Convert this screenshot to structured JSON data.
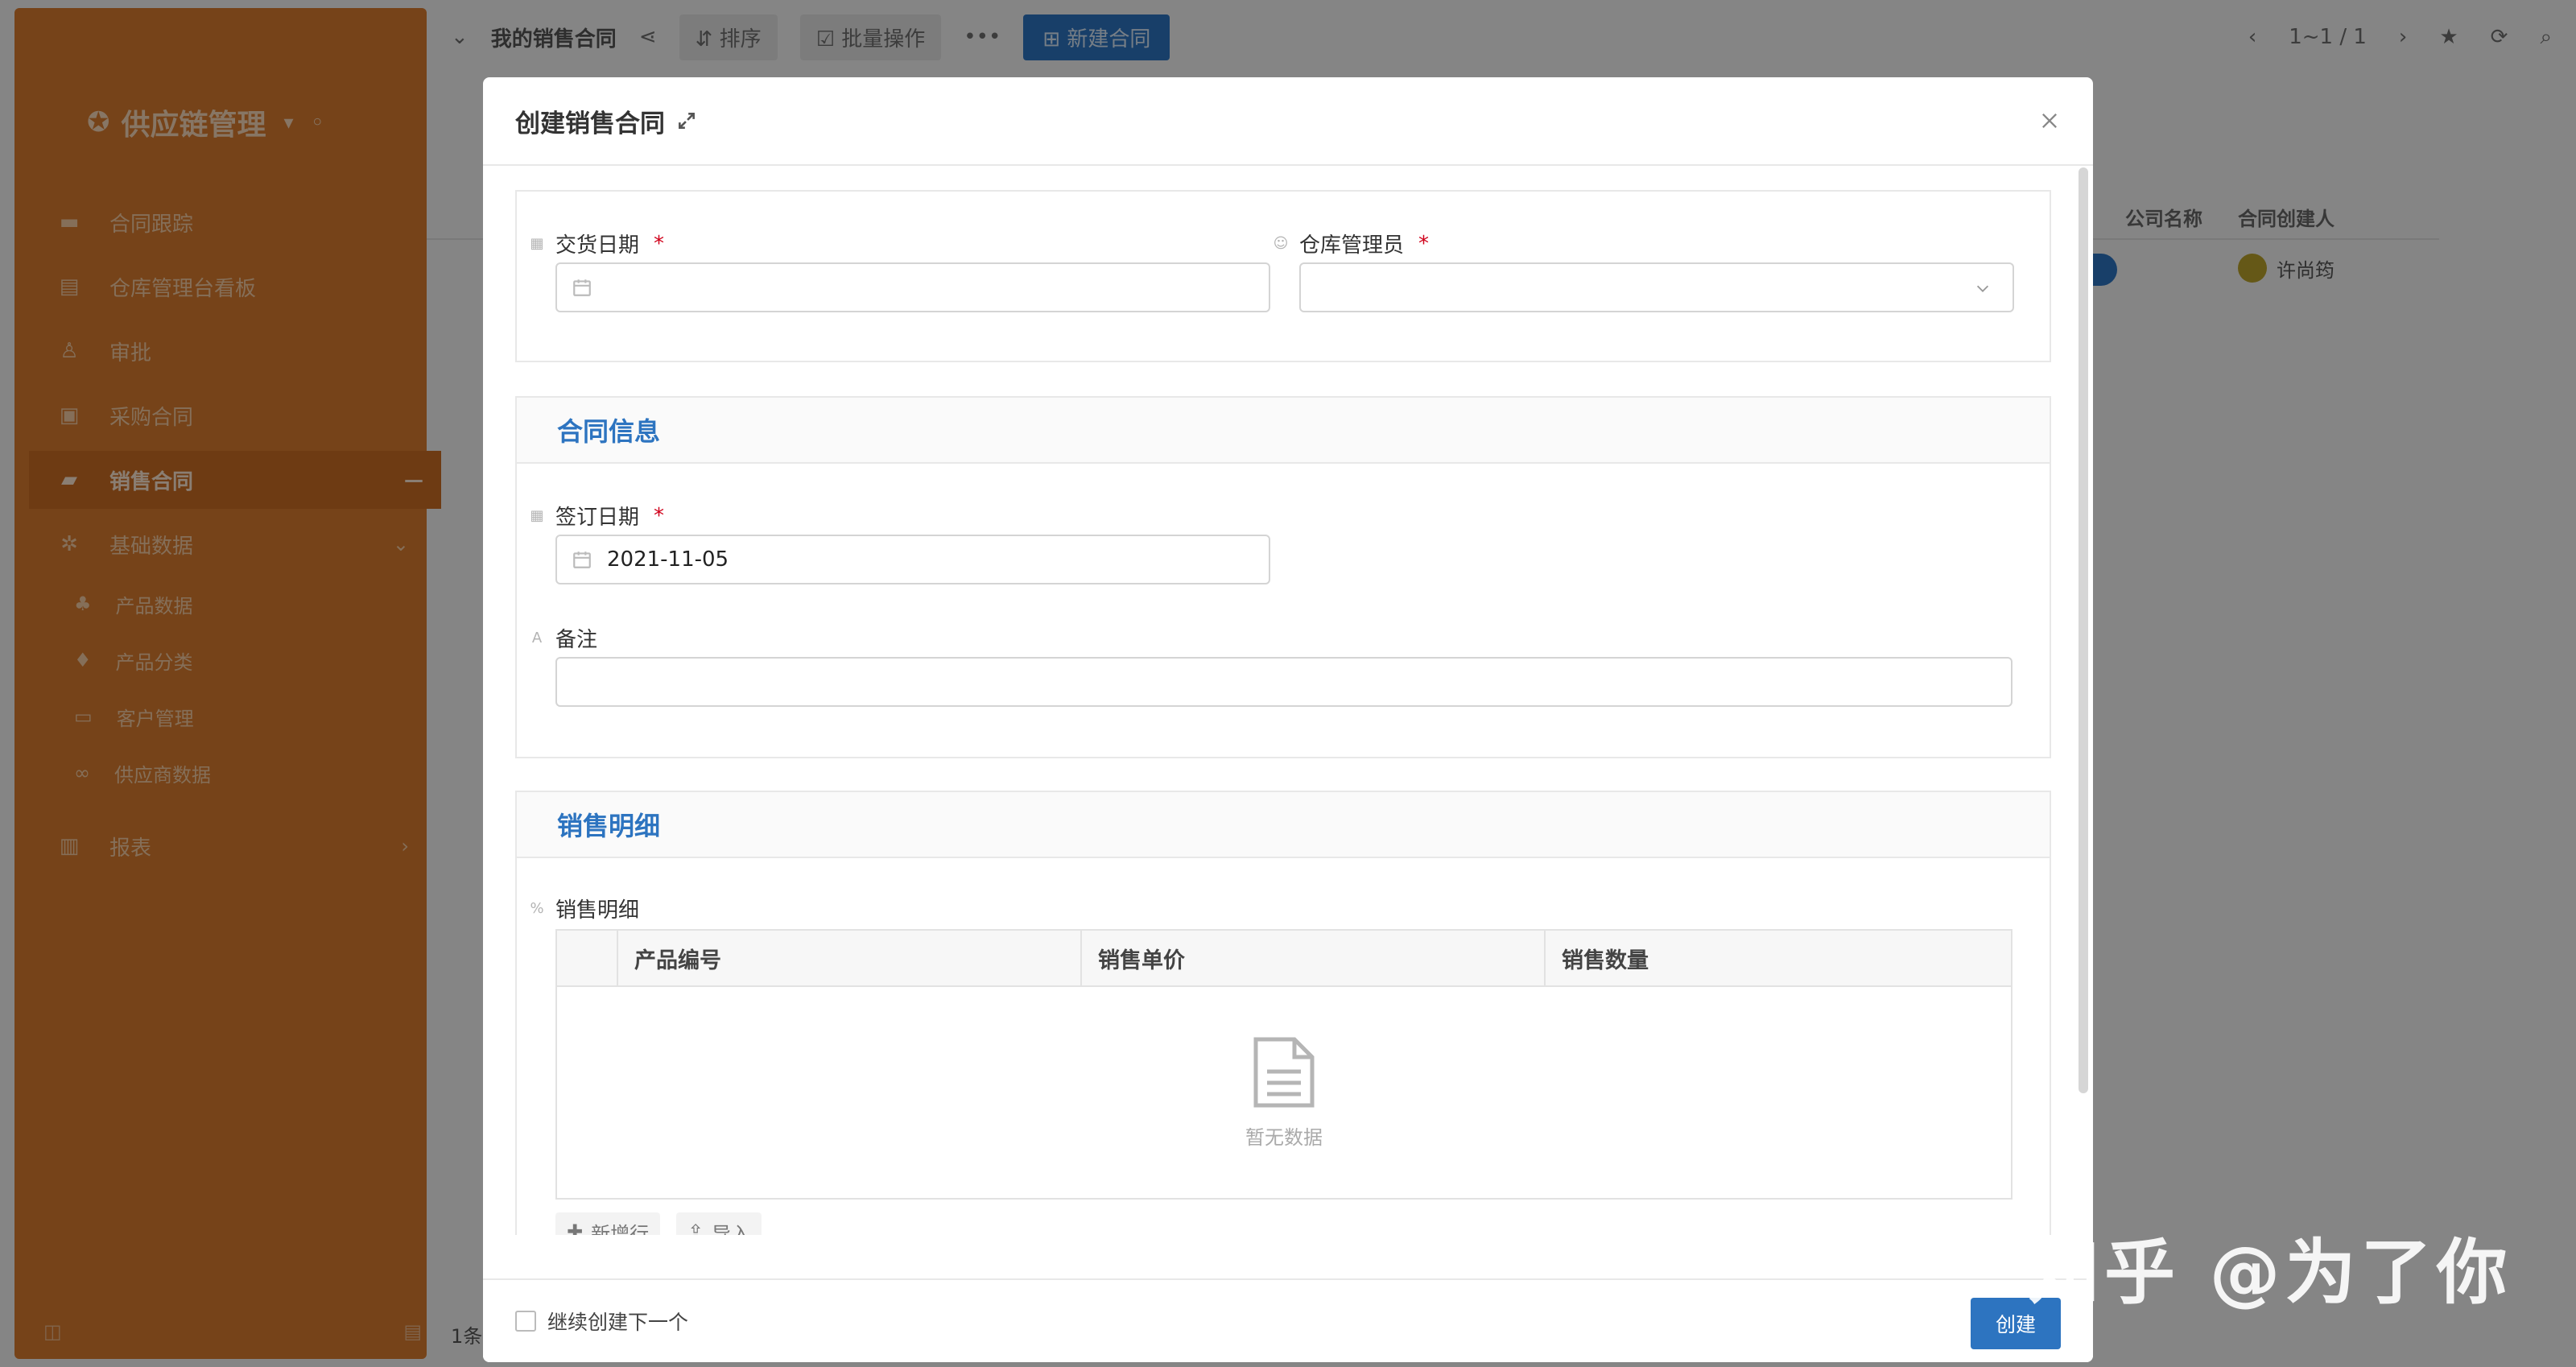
{
  "app": {
    "brand": "供应链管理",
    "sidebar": {
      "items": [
        {
          "label": "合同跟踪",
          "icon": "chat-icon"
        },
        {
          "label": "仓库管理台看板",
          "icon": "board-icon"
        },
        {
          "label": "审批",
          "icon": "user-icon"
        },
        {
          "label": "采购合同",
          "icon": "cart-icon"
        },
        {
          "label": "销售合同",
          "icon": "doc-icon",
          "active": true
        },
        {
          "label": "基础数据",
          "icon": "settings-icon"
        },
        {
          "label": "报表",
          "icon": "chart-icon"
        }
      ],
      "sub_items": [
        {
          "label": "产品数据"
        },
        {
          "label": "产品分类"
        },
        {
          "label": "客户管理"
        },
        {
          "label": "供应商数据"
        }
      ]
    },
    "topbar": {
      "title": "我的销售合同",
      "sort_label": "排序",
      "batch_label": "批量操作",
      "new_label": "新建合同",
      "pager": "1~1 / 1"
    },
    "table": {
      "headers": [
        "公司名称",
        "合同创建人"
      ],
      "row": {
        "creator": "许尚筠"
      },
      "footer": "1条"
    }
  },
  "modal": {
    "title": "创建销售合同",
    "top_section": {
      "delivery_date_label": "交货日期",
      "delivery_date_value": "",
      "warehouse_manager_label": "仓库管理员",
      "warehouse_manager_value": ""
    },
    "contract_section": {
      "title": "合同信息",
      "sign_date_label": "签订日期",
      "sign_date_value": "2021-11-05",
      "remark_label": "备注",
      "remark_value": ""
    },
    "sales_section": {
      "title": "销售明细",
      "field_label": "销售明细",
      "columns": [
        "产品编号",
        "销售单价",
        "销售数量"
      ],
      "empty_text": "暂无数据",
      "add_row_label": "新增行",
      "import_label": "导入"
    },
    "footer": {
      "continue_label": "继续创建下一个",
      "create_label": "创建"
    }
  },
  "watermark": "知乎 @为了你",
  "colors": {
    "accent": "#2d74c0",
    "sidebar": "#d77a2e",
    "required": "#d0021b"
  }
}
